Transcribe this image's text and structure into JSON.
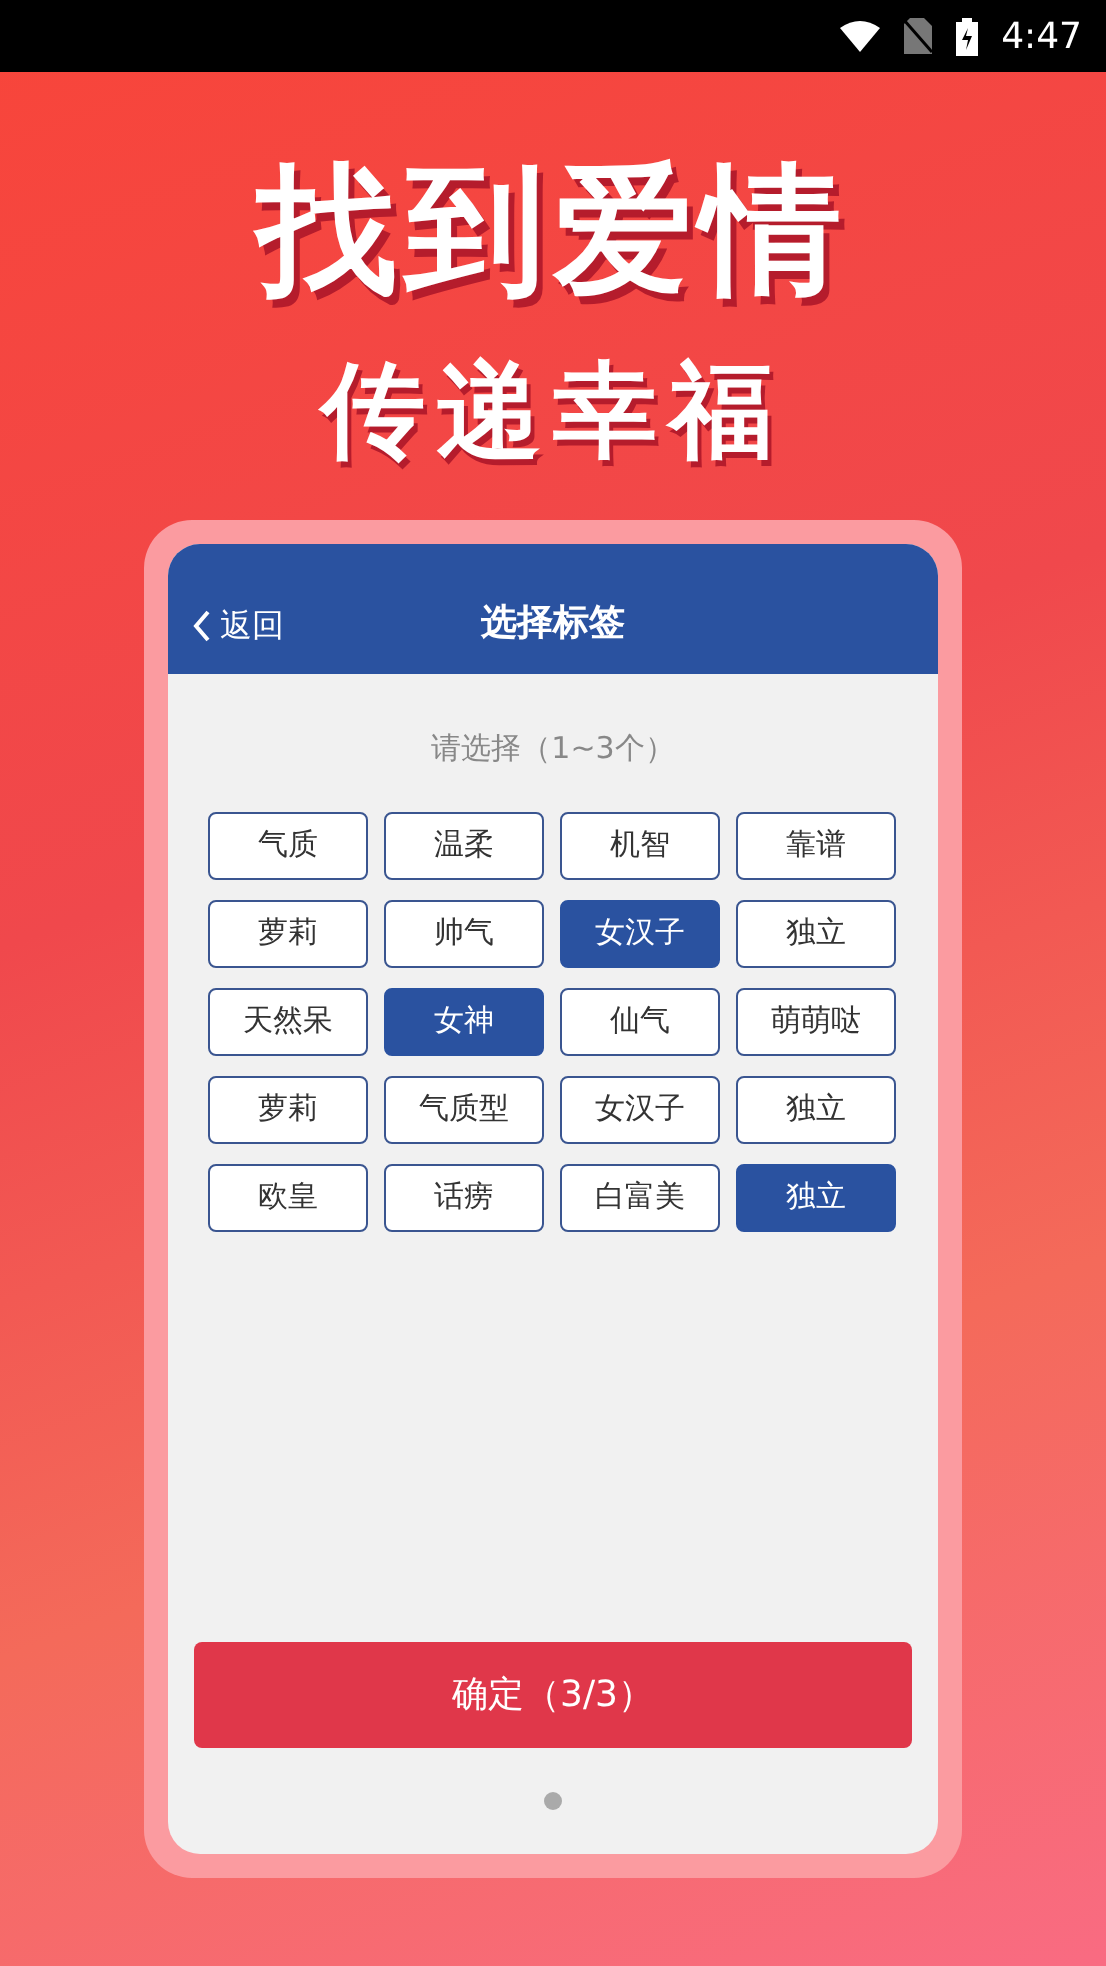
{
  "status_bar": {
    "time": "4:47"
  },
  "hero": {
    "title": "找到爱情",
    "subtitle": "传递幸福"
  },
  "header": {
    "back": "返回",
    "title": "选择标签"
  },
  "prompt": "请选择（1~3个）",
  "tags": [
    {
      "label": "气质",
      "selected": false
    },
    {
      "label": "温柔",
      "selected": false
    },
    {
      "label": "机智",
      "selected": false
    },
    {
      "label": "靠谱",
      "selected": false
    },
    {
      "label": "萝莉",
      "selected": false
    },
    {
      "label": "帅气",
      "selected": false
    },
    {
      "label": "女汉子",
      "selected": true
    },
    {
      "label": "独立",
      "selected": false
    },
    {
      "label": "天然呆",
      "selected": false
    },
    {
      "label": "女神",
      "selected": true
    },
    {
      "label": "仙气",
      "selected": false
    },
    {
      "label": "萌萌哒",
      "selected": false
    },
    {
      "label": "萝莉",
      "selected": false
    },
    {
      "label": "气质型",
      "selected": false
    },
    {
      "label": "女汉子",
      "selected": false
    },
    {
      "label": "独立",
      "selected": false
    },
    {
      "label": "欧皇",
      "selected": false
    },
    {
      "label": "话痨",
      "selected": false
    },
    {
      "label": "白富美",
      "selected": false
    },
    {
      "label": "独立",
      "selected": true
    }
  ],
  "confirm_button": "确定（3/3）"
}
